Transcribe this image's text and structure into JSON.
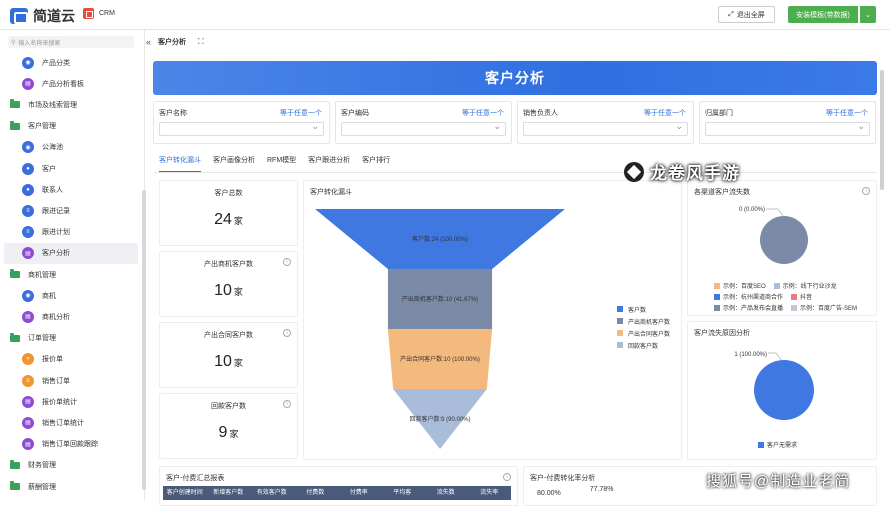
{
  "header": {
    "logo_text": "简道云",
    "app_name": "CRM",
    "exit_fullscreen": "退出全屏",
    "install_template": "安装模板(带数据)"
  },
  "sidebar": {
    "search_placeholder": "输入名称来搜索",
    "items": [
      {
        "label": "产品分类",
        "kind": "sub",
        "icon": "blue-circle-icon"
      },
      {
        "label": "产品分析看板",
        "kind": "sub",
        "icon": "purple-chart-icon"
      },
      {
        "label": "市场及线索管理",
        "kind": "group",
        "icon": "folder-icon"
      },
      {
        "label": "客户管理",
        "kind": "group",
        "icon": "folder-icon"
      },
      {
        "label": "公海池",
        "kind": "sub",
        "icon": "blue-circle-icon"
      },
      {
        "label": "客户",
        "kind": "sub",
        "icon": "blue-user-icon"
      },
      {
        "label": "联系人",
        "kind": "sub",
        "icon": "blue-user-icon"
      },
      {
        "label": "跟进记录",
        "kind": "sub",
        "icon": "blue-list-icon"
      },
      {
        "label": "跟进计划",
        "kind": "sub",
        "icon": "blue-list-icon"
      },
      {
        "label": "客户分析",
        "kind": "sub",
        "icon": "purple-chart-icon"
      },
      {
        "label": "商机管理",
        "kind": "group",
        "icon": "folder-icon"
      },
      {
        "label": "商机",
        "kind": "sub",
        "icon": "blue-circle-icon"
      },
      {
        "label": "商机分析",
        "kind": "sub",
        "icon": "purple-chart-icon"
      },
      {
        "label": "订单管理",
        "kind": "group",
        "icon": "folder-icon"
      },
      {
        "label": "报价单",
        "kind": "sub",
        "icon": "orange-arrow-icon"
      },
      {
        "label": "销售订单",
        "kind": "sub",
        "icon": "orange-list-icon"
      },
      {
        "label": "报价单统计",
        "kind": "sub",
        "icon": "purple-chart-icon"
      },
      {
        "label": "销售订单统计",
        "kind": "sub",
        "icon": "purple-chart-icon"
      },
      {
        "label": "销售订单回款跟踪",
        "kind": "sub",
        "icon": "purple-chart-icon"
      },
      {
        "label": "财务管理",
        "kind": "group",
        "icon": "folder-icon"
      },
      {
        "label": "薪酬管理",
        "kind": "group",
        "icon": "folder-icon"
      }
    ]
  },
  "breadcrumb": {
    "title": "客户分析"
  },
  "banner": {
    "title": "客户分析"
  },
  "filters": [
    {
      "label": "客户名称",
      "operator": "等于任意一个"
    },
    {
      "label": "客户编码",
      "operator": "等于任意一个"
    },
    {
      "label": "销售负责人",
      "operator": "等于任意一个"
    },
    {
      "label": "归属部门",
      "operator": "等于任意一个"
    }
  ],
  "tabs": [
    "客户转化漏斗",
    "客户画像分析",
    "RFM模型",
    "客户跟进分析",
    "客户排行"
  ],
  "metrics": [
    {
      "label": "客户总数",
      "value": "24",
      "unit": "家"
    },
    {
      "label": "产出商机客户数",
      "value": "10",
      "unit": "家"
    },
    {
      "label": "产出合同客户数",
      "value": "10",
      "unit": "家"
    },
    {
      "label": "回款客户数",
      "value": "9",
      "unit": "家"
    }
  ],
  "funnel": {
    "title": "客户转化漏斗",
    "stages": [
      {
        "name": "客户数",
        "value": 24,
        "label": "客户数:24 (100.00%)",
        "color": "#3f78e0"
      },
      {
        "name": "产出商机客户数",
        "value": 10,
        "label": "产出商机客户数:10 (41.67%)",
        "color": "#7b8aa6"
      },
      {
        "name": "产出合同客户数",
        "value": 10,
        "label": "产出合同客户数:10 (100.00%)",
        "color": "#f4b97c"
      },
      {
        "name": "回款客户数",
        "value": 9,
        "label": "回款客户数:9 (90.00%)",
        "color": "#a9bddb"
      }
    ]
  },
  "channel_pie": {
    "title": "各渠道客户流失数",
    "label": "0 (0.00%)",
    "legend": [
      {
        "name": "示例：百度SEO",
        "color": "#f4b97c"
      },
      {
        "name": "示例：线下行业沙龙",
        "color": "#a9bddb"
      },
      {
        "name": "示例：杭州渠道商合作",
        "color": "#3f78e0"
      },
      {
        "name": "抖音",
        "color": "#e97c7c"
      },
      {
        "name": "示例：产品发布会直播",
        "color": "#7b8aa6"
      },
      {
        "name": "示例：百度广告-SEM",
        "color": "#c0c8d8"
      }
    ]
  },
  "loss_pie": {
    "title": "客户流失原因分析",
    "label": "1 (100.00%)",
    "legend": [
      {
        "name": "客户无需求",
        "color": "#3f78e0"
      }
    ]
  },
  "payment_table": {
    "title": "客户-付费汇总报表",
    "headers": [
      "客户创建时间",
      "新增客户数",
      "有效客户数",
      "付费数",
      "付费率",
      "平均客",
      "流失数",
      "流失率"
    ]
  },
  "rate_chart": {
    "title": "客户-付费转化率分析",
    "ytick": "80.00%",
    "value_label": "77.78%"
  },
  "watermarks": {
    "top": "龙卷风手游",
    "bottom": "搜狐号@制造业老简"
  }
}
